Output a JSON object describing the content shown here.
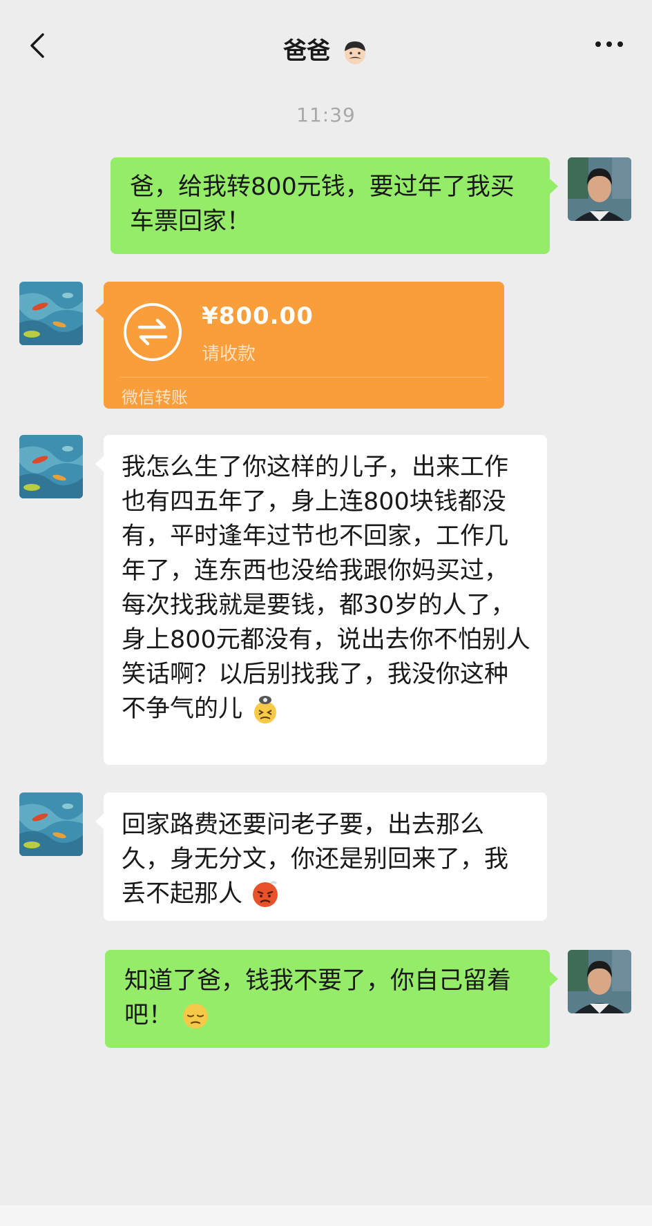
{
  "header": {
    "title": "爸爸",
    "title_emoji": "man-emoji",
    "back_icon": "chevron-left-icon",
    "more_icon": "more-dots-icon"
  },
  "timestamp": "11:39",
  "messages": [
    {
      "sender": "me",
      "type": "text",
      "text": "爸，给我转800元钱，要过年了我买车票回家！"
    },
    {
      "sender": "dad",
      "type": "transfer",
      "amount": "¥800.00",
      "status": "请收款",
      "footer": "微信转账"
    },
    {
      "sender": "dad",
      "type": "text",
      "text": "我怎么生了你这样的儿子，出来工作也有四五年了，身上连800块钱都没有，平时逢年过节也不回家，工作几年了，连东西也没给我跟你妈买过，每次找我就是要钱，都30岁的人了，身上800元都没有，说出去你不怕别人笑话啊？以后别找我了，我没你这种不争气的儿",
      "emoji": "angry-smoke-emoji"
    },
    {
      "sender": "dad",
      "type": "text",
      "text": "回家路费还要问老子要，出去那么久，身无分文，你还是别回来了，我丢不起那人",
      "emoji": "angry-red-face-emoji"
    },
    {
      "sender": "me",
      "type": "text",
      "text": "知道了爸，钱我不要了，你自己留着吧！",
      "emoji": "pensive-face-emoji"
    }
  ],
  "colors": {
    "background": "#ededed",
    "sent_bubble": "#95ec69",
    "received_bubble": "#ffffff",
    "transfer_card": "#fa9d3b"
  }
}
